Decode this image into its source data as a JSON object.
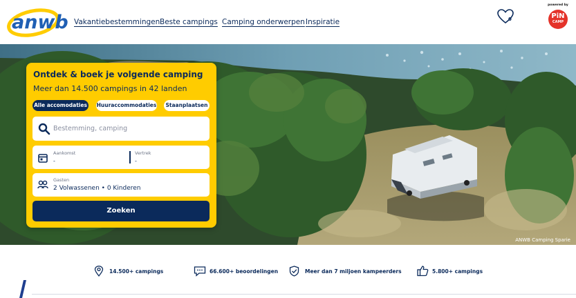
{
  "header": {
    "logo_text": "anwb",
    "nav": [
      {
        "label": "Vakantiebestemmingen"
      },
      {
        "label": "Beste campings"
      },
      {
        "label": "Camping onderwerpen"
      },
      {
        "label": "Inspiratie"
      }
    ],
    "favorites_count": "0",
    "partner": {
      "powered_by": "powered by",
      "name_line1": "PiN",
      "name_line2": "CAMP"
    }
  },
  "hero": {
    "photo_credit": "ANWB Camping Sparie"
  },
  "search_card": {
    "title": "Ontdek & boek je volgende camping",
    "subtitle": "Meer dan 14.500 campings in 42 landen",
    "filters": [
      {
        "label": "Alle accomodaties",
        "active": true
      },
      {
        "label": "Huuraccommodaties",
        "active": false
      },
      {
        "label": "Staanplaatsen",
        "active": false
      }
    ],
    "destination_placeholder": "Bestemming, camping",
    "arrival_label": "Aankomst",
    "arrival_value": "-",
    "departure_label": "Vertrek",
    "departure_value": "-",
    "guests_label": "Gasten",
    "guests_value": "2 Volwassenen • 0 Kinderen",
    "submit_label": "Zoeken"
  },
  "usps": [
    {
      "icon": "location-pin-icon",
      "text": "14.500+ campings"
    },
    {
      "icon": "chat-bubble-icon",
      "text": "66.600+ beoordelingen"
    },
    {
      "icon": "shield-check-icon",
      "text": "Meer dan 7 miljoen kampeerders"
    },
    {
      "icon": "thumbs-up-icon",
      "text": "5.800+ campings"
    }
  ],
  "colors": {
    "brand_navy": "#0b2a5b",
    "brand_yellow": "#ffcc00",
    "logo_blue": "#1f5fb4",
    "partner_red": "#e4332a"
  }
}
